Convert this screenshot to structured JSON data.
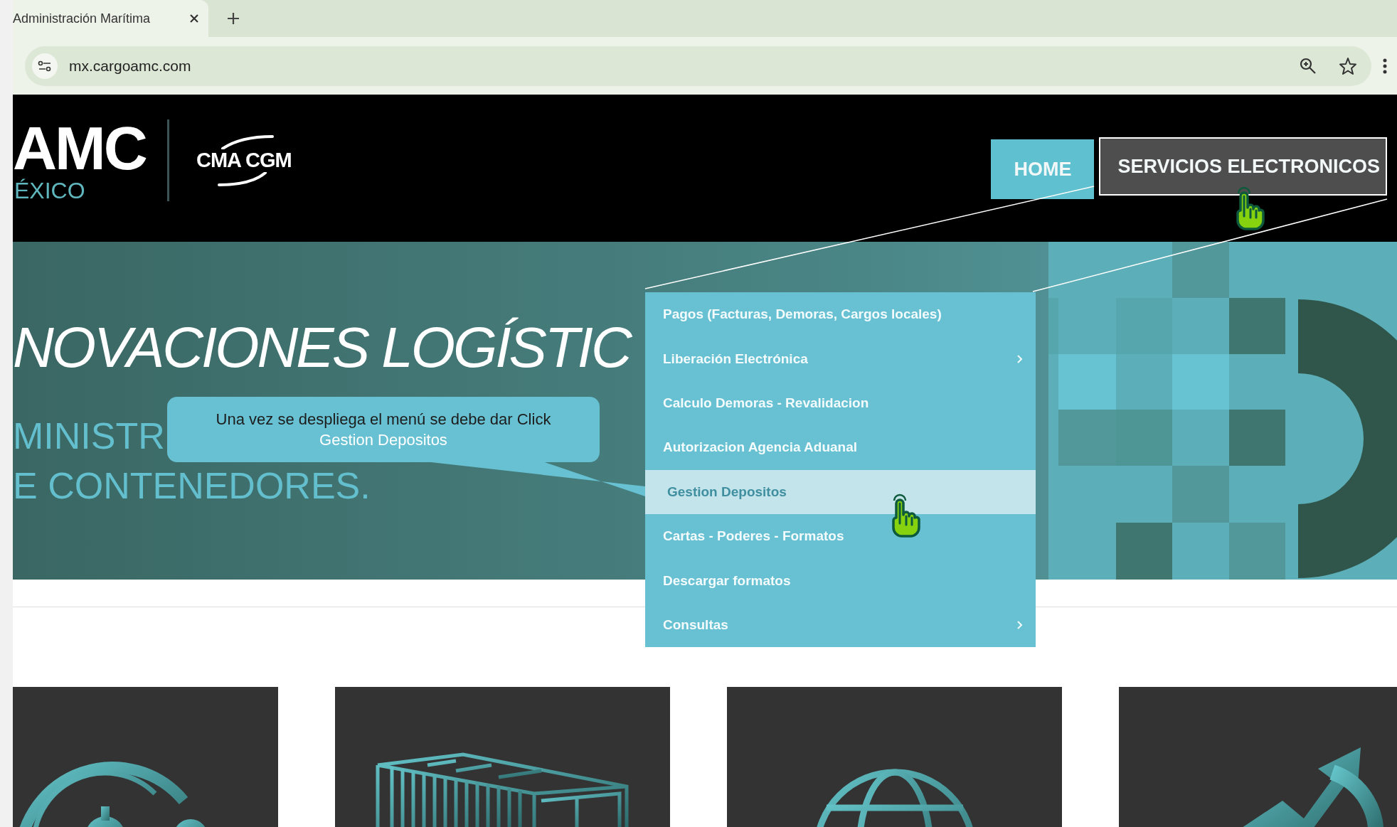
{
  "browser": {
    "tab": {
      "title": "Administración Marítima"
    },
    "address": "mx.cargoamc.com"
  },
  "header": {
    "logo": {
      "brand": "AMC",
      "region": "ÉXICO",
      "partner": "CMA CGM"
    },
    "nav": [
      {
        "label": "HOME",
        "selected": true,
        "expanded": false
      },
      {
        "label": "SERVICIOS ELECTRONICOS",
        "selected": false,
        "expanded": true
      }
    ]
  },
  "banner": {
    "headline": "NOVACIONES LOGÍSTIC",
    "subtitle_lines": [
      "MINISTR",
      "E CONTENEDORES."
    ]
  },
  "dropdown_menu": {
    "items": [
      {
        "label": "Pagos (Facturas, Demoras, Cargos locales)",
        "selected": false,
        "has_submenu": false
      },
      {
        "label": "Liberación Electrónica",
        "selected": false,
        "has_submenu": true
      },
      {
        "label": "Calculo Demoras - Revalidacion",
        "selected": false,
        "has_submenu": false
      },
      {
        "label": "Autorizacion Agencia Aduanal",
        "selected": false,
        "has_submenu": false
      },
      {
        "label": "Gestion Depositos",
        "selected": true,
        "has_submenu": false
      },
      {
        "label": "Cartas - Poderes - Formatos",
        "selected": false,
        "has_submenu": false
      },
      {
        "label": "Descargar formatos",
        "selected": false,
        "has_submenu": false
      },
      {
        "label": "Consultas",
        "selected": false,
        "has_submenu": true
      }
    ]
  },
  "callout": {
    "text": "Una vez se despliega el menú se debe dar Click",
    "highlight": "Gestion Depositos"
  }
}
